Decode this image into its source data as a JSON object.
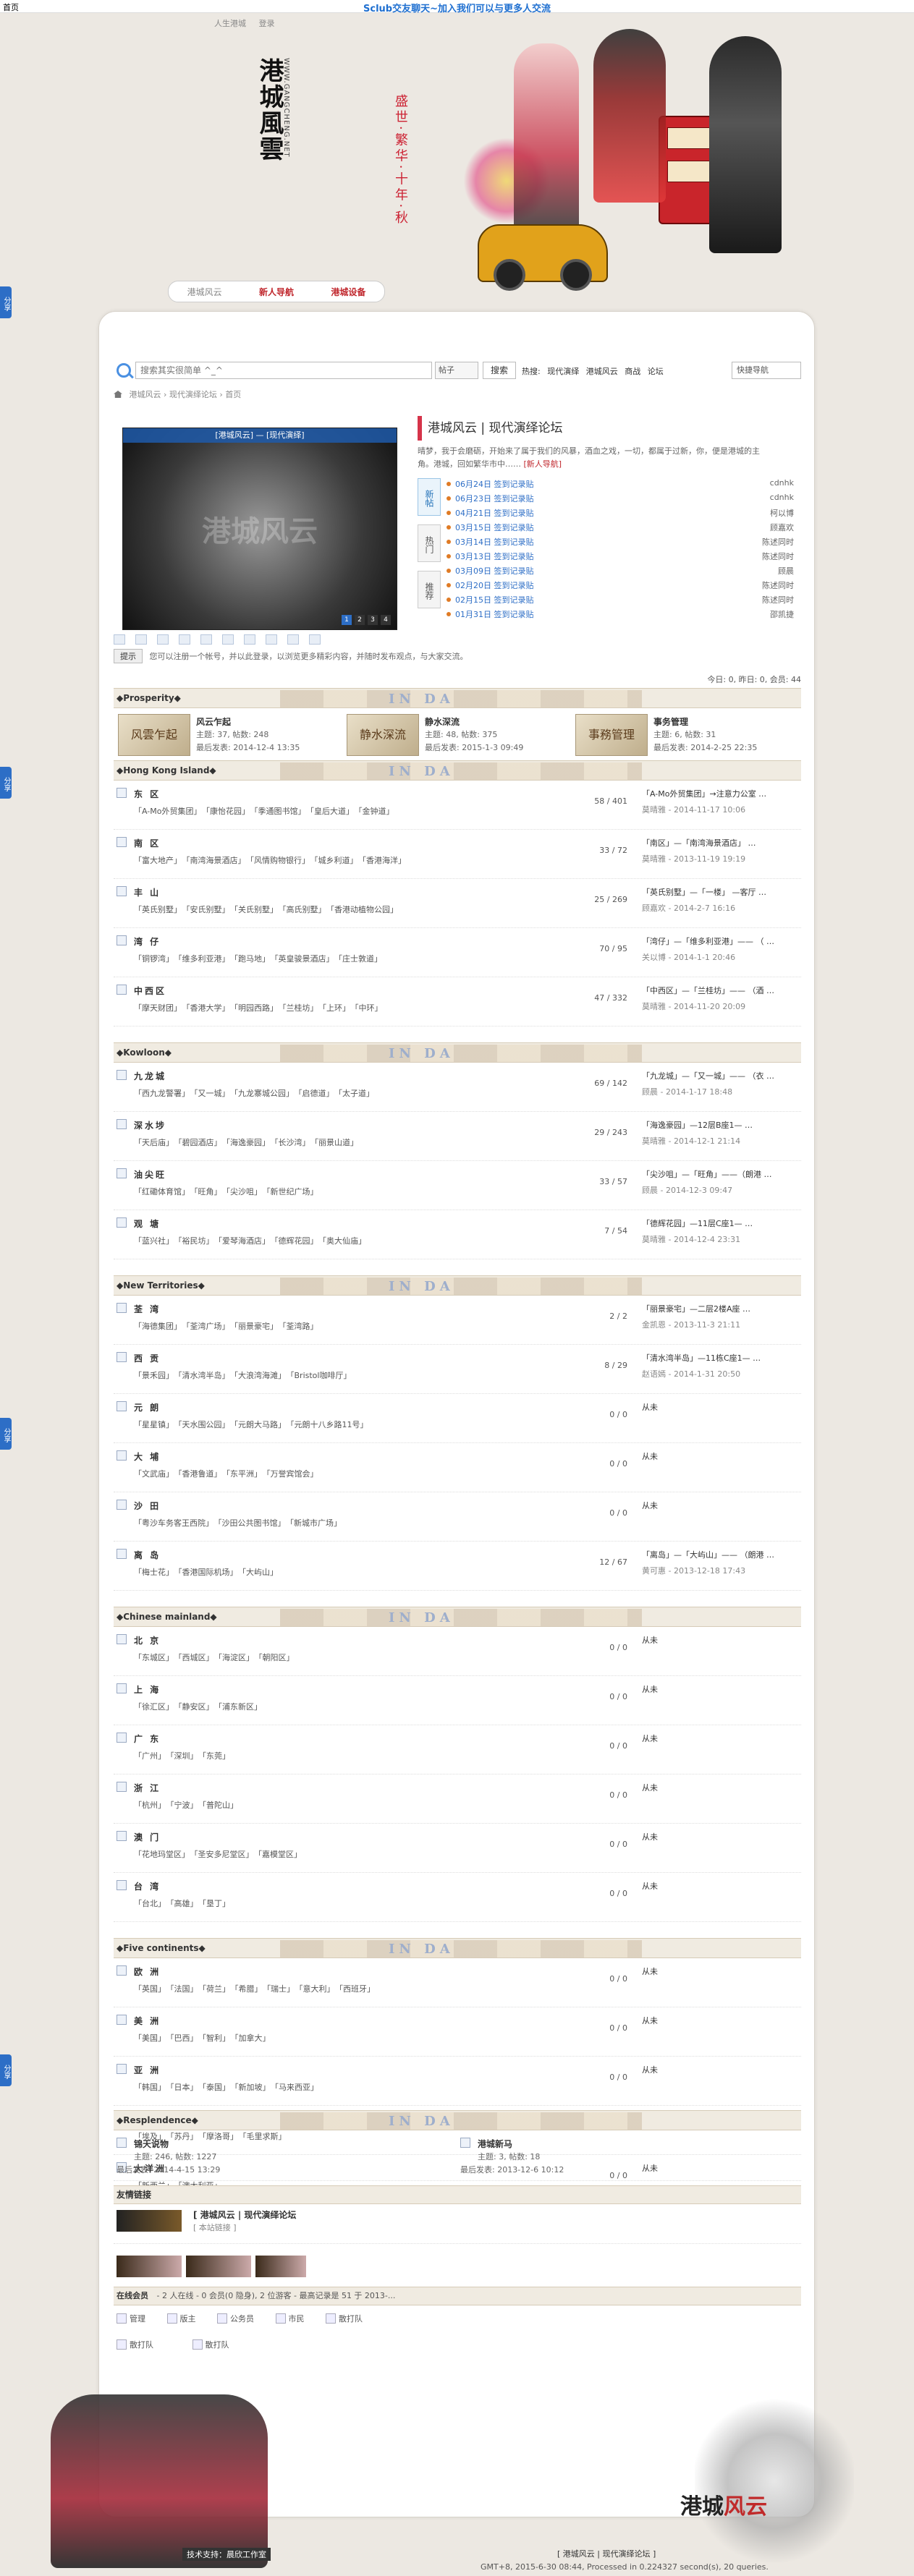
{
  "topbar": {
    "home": "首页",
    "notice": "Sclub交友聊天~加入我们可以与更多人交流"
  },
  "topnav": [
    "人生港城",
    "登录"
  ],
  "hero": {
    "logo": "港城風雲",
    "logo_sub": "WWW.GANGCHENG.NET",
    "tagline": "盛世·繁华·十年·秋",
    "tabs": [
      "港城风云",
      "新人导航",
      "港城设备"
    ]
  },
  "side_tabs": [
    "分享",
    "分享",
    "分享",
    "分享"
  ],
  "search": {
    "placeholder": "搜索其实很简单 ^_^",
    "type": "帖子",
    "button": "搜索",
    "hot_label": "热搜:",
    "hot": [
      "现代演绎",
      "港城风云",
      "商战",
      "论坛"
    ],
    "quicknav": "快捷导航"
  },
  "breadcrumb": [
    "港城风云",
    "现代演绎论坛",
    "首页"
  ],
  "slideshow": {
    "caption": "[港城风云] — [现代演绎]",
    "bigtext": "港城风云",
    "dots": [
      "1",
      "2",
      "3",
      "4"
    ]
  },
  "site": {
    "title": "港城风云 | 现代演绎论坛",
    "desc": "晴梦，我于会磨砺，开始来了属于我们的风暴，酒血之戏，一切，都属于过新，你，便是港城的主角。港城，回如繁华市中……",
    "desc_link": "[新人导航]"
  },
  "news": {
    "badges": [
      "新帖",
      "热门",
      "推荐"
    ],
    "rows": [
      {
        "text": "06月24日 签到记录贴",
        "author": "cdnhk"
      },
      {
        "text": "06月23日 签到记录贴",
        "author": "cdnhk"
      },
      {
        "text": "04月21日 签到记录贴",
        "author": "柯以博"
      },
      {
        "text": "03月15日 签到记录贴",
        "author": "顾嘉欢"
      },
      {
        "text": "03月14日 签到记录贴",
        "author": "陈述同时"
      },
      {
        "text": "03月13日 签到记录贴",
        "author": "陈述同时"
      },
      {
        "text": "03月09日 签到记录贴",
        "author": "顾晨"
      },
      {
        "text": "02月20日 签到记录贴",
        "author": "陈述同时"
      },
      {
        "text": "02月15日 签到记录贴",
        "author": "陈述同时"
      },
      {
        "text": "01月31日 签到记录贴",
        "author": "邵凯捷"
      }
    ]
  },
  "notice": {
    "label": "提示",
    "text": "您可以注册一个帐号，并以此登录，以浏览更多精彩内容，并随时发布观点，与大家交流。"
  },
  "stats": "今日: 0, 昨日: 0, 会员: 44",
  "prosperity": {
    "title": "◆Prosperity◆",
    "banner": "IN DA",
    "cells": [
      {
        "img": "风雲乍起",
        "name": "风云乍起",
        "meta": "主题: 37, 帖数: 248",
        "date": "最后发表: 2014-12-4 13:35"
      },
      {
        "img": "静水深流",
        "name": "静水深流",
        "meta": "主题: 48, 帖数: 375",
        "date": "最后发表: 2015-1-3 09:49"
      },
      {
        "img": "事務管理",
        "name": "事务管理",
        "meta": "主题: 6, 帖数: 31",
        "date": "最后发表: 2014-2-25 22:35"
      }
    ]
  },
  "categories": [
    {
      "title": "◆Hong Kong Island◆",
      "forums": [
        {
          "name": "东 区",
          "sub": [
            "「A-Mo外贸集团」",
            "「康怡花园」",
            "「季通图书馆」",
            "「皇后大道」",
            "「金钟道」"
          ],
          "count": "58 / 401",
          "last1": "「A-Mo外贸集团」→注意力公室 …",
          "last2": "莫晴雅 - 2014-11-17 10:06"
        },
        {
          "name": "南 区",
          "sub": [
            "「富大地产」",
            "「南湾海景酒店」",
            "「风情购物银行」",
            "「城乡利道」",
            "「香港海洋」"
          ],
          "count": "33 / 72",
          "last1": "「南区」—「南湾海景酒店」 …",
          "last2": "莫晴雅 - 2013-11-19 19:19"
        },
        {
          "name": "丰 山",
          "sub": [
            "「英氏别墅」",
            "「安氏别墅」",
            "「关氏别墅」",
            "「高氏别墅」",
            "「香港动植物公园」"
          ],
          "count": "25 / 269",
          "last1": "「英氏别墅」—「一楼」 —客厅 …",
          "last2": "顾嘉欢 - 2014-2-7 16:16"
        },
        {
          "name": "湾 仔",
          "sub": [
            "「铜锣湾」",
            "「维多利亚港」",
            "「跑马地」",
            "「英皇骏景酒店」",
            "「庄士敦道」"
          ],
          "count": "70 / 95",
          "last1": "「湾仔」—「维多利亚港」—— （ …",
          "last2": "关以博 - 2014-1-1 20:46"
        },
        {
          "name": "中西区",
          "sub": [
            "「摩天财团」",
            "「香港大学」",
            "「明园西路」",
            "「兰桂坊」",
            "「上环」",
            "「中环」"
          ],
          "count": "47 / 332",
          "last1": "「中西区」—「兰桂坊」—— （酒 …",
          "last2": "莫晴雅 - 2014-11-20 20:09"
        }
      ]
    },
    {
      "title": "◆Kowloon◆",
      "forums": [
        {
          "name": "九龙城",
          "sub": [
            "「西九龙警署」",
            "「又一城」",
            "「九龙寨城公园」",
            "「启德道」",
            "「太子道」"
          ],
          "count": "69 / 142",
          "last1": "「九龙城」—「又一城」—— （衣 …",
          "last2": "顾晨 - 2014-1-17 18:48"
        },
        {
          "name": "深水埗",
          "sub": [
            "「天后庙」",
            "「碧园酒店」",
            "「海逸豪园」",
            "「长沙湾」",
            "「丽景山道」"
          ],
          "count": "29 / 243",
          "last1": "「海逸豪园」—12层B座1— …",
          "last2": "莫晴雅 - 2014-12-1 21:14"
        },
        {
          "name": "油尖旺",
          "sub": [
            "「红磡体育馆」",
            "「旺角」",
            "「尖沙咀」",
            "「新世纪广场」"
          ],
          "count": "33 / 57",
          "last1": "「尖沙咀」—「旺角」——（朗港 …",
          "last2": "顾晨 - 2014-12-3 09:47"
        },
        {
          "name": "观 塘",
          "sub": [
            "「蓝兴社」",
            "「裕民坊」",
            "「爱琴海酒店」",
            "「德辉花园」",
            "「奥大仙庙」"
          ],
          "count": "7 / 54",
          "last1": "「德辉花园」—11层C座1— …",
          "last2": "莫晴雅 - 2014-12-4 23:31"
        }
      ]
    },
    {
      "title": "◆New Territories◆",
      "forums": [
        {
          "name": "荃 湾",
          "sub": [
            "「海德集团」",
            "「荃湾广场」",
            "「丽景豪宅」",
            "「荃湾路」"
          ],
          "count": "2 / 2",
          "last1": "「丽景豪宅」—二层2楼A座 …",
          "last2": "金凯恩 - 2013-11-3 21:11"
        },
        {
          "name": "西 贡",
          "sub": [
            "「景禾园」",
            "「清水湾半岛」",
            "「大浪湾海滩」",
            "「Bristol咖啡厅」"
          ],
          "count": "8 / 29",
          "last1": "「清水湾半岛」—11栋C座1— …",
          "last2": "赵语嫣 - 2014-1-31 20:50"
        },
        {
          "name": "元 朗",
          "sub": [
            "「星星镇」",
            "「天水围公园」",
            "「元朗大马路」",
            "「元朗十八乡路11号」"
          ],
          "count": "0 / 0",
          "last1": "从未",
          "last2": ""
        },
        {
          "name": "大 埔",
          "sub": [
            "「文武庙」",
            "「香港鲁道」",
            "「东平洲」",
            "「万誉宾馆会」"
          ],
          "count": "0 / 0",
          "last1": "从未",
          "last2": ""
        },
        {
          "name": "沙 田",
          "sub": [
            "「粤沙车务客王西院」",
            "「沙田公共图书馆」",
            "「新城市广场」"
          ],
          "count": "0 / 0",
          "last1": "从未",
          "last2": ""
        },
        {
          "name": "离 岛",
          "sub": [
            "「梅士花」",
            "「香港国际机场」",
            "「大屿山」"
          ],
          "count": "12 / 67",
          "last1": "「离岛」—「大屿山」—— （朗港 …",
          "last2": "黄可惠 - 2013-12-18 17:43"
        }
      ]
    },
    {
      "title": "◆Chinese mainland◆",
      "forums": [
        {
          "name": "北 京",
          "sub": [
            "「东城区」",
            "「西城区」",
            "「海淀区」",
            "「朝阳区」"
          ],
          "count": "0 / 0",
          "last1": "从未",
          "last2": ""
        },
        {
          "name": "上 海",
          "sub": [
            "「徐汇区」",
            "「静安区」",
            "「浦东新区」"
          ],
          "count": "0 / 0",
          "last1": "从未",
          "last2": ""
        },
        {
          "name": "广 东",
          "sub": [
            "「广州」",
            "「深圳」",
            "「东莞」"
          ],
          "count": "0 / 0",
          "last1": "从未",
          "last2": ""
        },
        {
          "name": "浙 江",
          "sub": [
            "「杭州」",
            "「宁波」",
            "「普陀山」"
          ],
          "count": "0 / 0",
          "last1": "从未",
          "last2": ""
        },
        {
          "name": "澳 门",
          "sub": [
            "「花地玛堂区」",
            "「圣安多尼堂区」",
            "「嘉模堂区」"
          ],
          "count": "0 / 0",
          "last1": "从未",
          "last2": ""
        },
        {
          "name": "台 湾",
          "sub": [
            "「台北」",
            "「高雄」",
            "「垦丁」"
          ],
          "count": "0 / 0",
          "last1": "从未",
          "last2": ""
        }
      ]
    },
    {
      "title": "◆Five continents◆",
      "forums": [
        {
          "name": "欧 洲",
          "sub": [
            "「英国」",
            "「法国」",
            "「荷兰」",
            "「希腊」",
            "「瑞士」",
            "「意大利」",
            "「西班牙」"
          ],
          "count": "0 / 0",
          "last1": "从未",
          "last2": ""
        },
        {
          "name": "美 洲",
          "sub": [
            "「美国」",
            "「巴西」",
            "「智利」",
            "「加拿大」"
          ],
          "count": "0 / 0",
          "last1": "从未",
          "last2": ""
        },
        {
          "name": "亚 洲",
          "sub": [
            "「韩国」",
            "「日本」",
            "「泰国」",
            "「新加坡」",
            "「马来西亚」"
          ],
          "count": "0 / 0",
          "last1": "从未",
          "last2": ""
        },
        {
          "name": "非 洲",
          "sub": [
            "「埃及」",
            "「苏丹」",
            "「摩洛哥」",
            "「毛里求斯」"
          ],
          "count": "0 / 0",
          "last1": "从未",
          "last2": ""
        },
        {
          "name": "大洋洲",
          "sub": [
            "「新西兰」",
            "「澳大利亚」"
          ],
          "count": "0 / 0",
          "last1": "从未",
          "last2": ""
        }
      ]
    }
  ],
  "resplendence": {
    "title": "◆Resplendence◆",
    "cells": [
      {
        "name": "锦天说物",
        "meta": "主题: 246, 帖数: 1227",
        "date": "最后发表: 2014-4-15 13:29"
      },
      {
        "name": "港城新马",
        "meta": "主题: 3, 帖数: 18",
        "date": "最后发表: 2013-12-6 10:12"
      }
    ]
  },
  "friendlinks": {
    "title": "友情链接",
    "name": "[ 港城风云 | 现代演绎论坛",
    "desc": "[ 本站链接 ]"
  },
  "online": {
    "title": "在线会员",
    "summary": "- 2 人在线 - 0 会员(0 隐身), 2 位游客 - 最高记录是 51 于 2013-...",
    "legend": [
      "管理",
      "版主",
      "公务员",
      "市民",
      "散打队"
    ],
    "users": [
      "散打队",
      "散打队"
    ]
  },
  "footer": {
    "logo_a": "港城",
    "logo_b": "风云",
    "credit": "技术支持：晨欣工作室",
    "line1": "[ 港城风云 | 现代演绎论坛 ]",
    "line2": "GMT+8, 2015-6-30 08:44, Processed in 0.224327 second(s), 20 queries."
  }
}
